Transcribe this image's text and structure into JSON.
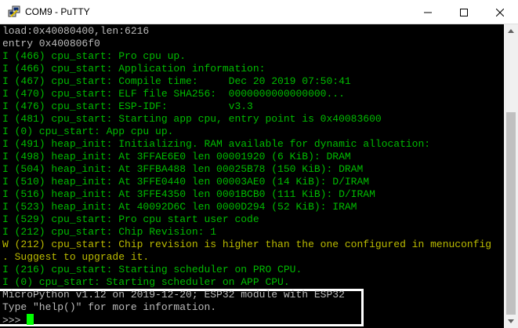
{
  "window": {
    "title": "COM9 - PuTTY",
    "controls": {
      "minimize": "—",
      "maximize": "☐",
      "close": "✕"
    }
  },
  "terminal": {
    "lines": [
      {
        "text": "load:0x40080400,len:6216",
        "color": "white"
      },
      {
        "text": "entry 0x400806f0",
        "color": "white"
      },
      {
        "text": "I (466) cpu_start: Pro cpu up.",
        "color": "green"
      },
      {
        "text": "I (466) cpu_start: Application information:",
        "color": "green"
      },
      {
        "text": "I (467) cpu_start: Compile time:     Dec 20 2019 07:50:41",
        "color": "green"
      },
      {
        "text": "I (470) cpu_start: ELF file SHA256:  0000000000000000...",
        "color": "green"
      },
      {
        "text": "I (476) cpu_start: ESP-IDF:          v3.3",
        "color": "green"
      },
      {
        "text": "I (481) cpu_start: Starting app cpu, entry point is 0x40083600",
        "color": "green"
      },
      {
        "text": "I (0) cpu_start: App cpu up.",
        "color": "green"
      },
      {
        "text": "I (491) heap_init: Initializing. RAM available for dynamic allocation:",
        "color": "green"
      },
      {
        "text": "I (498) heap_init: At 3FFAE6E0 len 00001920 (6 KiB): DRAM",
        "color": "green"
      },
      {
        "text": "I (504) heap_init: At 3FFBA488 len 00025B78 (150 KiB): DRAM",
        "color": "green"
      },
      {
        "text": "I (510) heap_init: At 3FFE0440 len 00003AE0 (14 KiB): D/IRAM",
        "color": "green"
      },
      {
        "text": "I (516) heap_init: At 3FFE4350 len 0001BCB0 (111 KiB): D/IRAM",
        "color": "green"
      },
      {
        "text": "I (523) heap_init: At 40092D6C len 0000D294 (52 KiB): IRAM",
        "color": "green"
      },
      {
        "text": "I (529) cpu_start: Pro cpu start user code",
        "color": "green"
      },
      {
        "text": "I (212) cpu_start: Chip Revision: 1",
        "color": "green"
      },
      {
        "text": "W (212) cpu_start: Chip revision is higher than the one configured in menuconfig",
        "color": "yellow"
      },
      {
        "text": ". Suggest to upgrade it.",
        "color": "yellow"
      },
      {
        "text": "I (216) cpu_start: Starting scheduler on PRO CPU.",
        "color": "green"
      },
      {
        "text": "I (0) cpu_start: Starting scheduler on APP CPU.",
        "color": "green"
      },
      {
        "text": "MicroPython v1.12 on 2019-12-20; ESP32 module with ESP32",
        "color": "white"
      },
      {
        "text": "Type \"help()\" for more information.",
        "color": "white"
      }
    ],
    "prompt": ">>> "
  },
  "colors": {
    "white": "#bbbbbb",
    "green": "#00bb00",
    "yellow": "#bbbb00",
    "cursor": "#00ff00",
    "background": "#000000"
  },
  "icons": {
    "app": "putty-icon",
    "scroll_up": "arrow-up-icon",
    "scroll_down": "arrow-down-icon"
  }
}
